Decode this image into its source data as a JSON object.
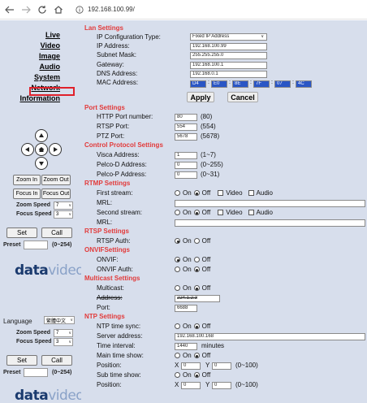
{
  "browser": {
    "url": "192.168.100.99/"
  },
  "sidebar": {
    "links": [
      "Live",
      "Video",
      "Image",
      "Audio",
      "System",
      "Network",
      "Information"
    ],
    "zoom_in": "Zoom In",
    "zoom_out": "Zoom Out",
    "focus_in": "Focus In",
    "focus_out": "Focus Out",
    "zoom_speed_label": "Zoom Speed",
    "zoom_speed_value": "7",
    "focus_speed_label": "Focus Speed",
    "focus_speed_value": "3",
    "set": "Set",
    "call": "Call",
    "preset_label": "Preset",
    "preset_range": "(0~254)",
    "logo_a": "data",
    "logo_b": "video",
    "language_label": "Language",
    "language_value": "繁體中文",
    "zoom_speed2_value": "7",
    "focus_speed2_value": "3",
    "set2": "Set",
    "call2": "Call",
    "preset2_label": "Preset",
    "preset2_range": "(0~254)"
  },
  "lan": {
    "title": "Lan Settings",
    "ip_type_label": "IP Configuration Type:",
    "ip_type_value": "Fixed IP Address",
    "ip_label": "IP Address:",
    "ip_value": "192.168.100.99",
    "mask_label": "Subnet Mask:",
    "mask_value": "255.255.255.0",
    "gateway_label": "Gateway:",
    "gateway_value": "192.168.100.1",
    "dns_label": "DNS Address:",
    "dns_value": "192.168.0.1",
    "mac_label": "MAC Address:",
    "mac": [
      "D4",
      "E0",
      "8E",
      "7F",
      "07",
      "4C"
    ],
    "apply": "Apply",
    "cancel": "Cancel"
  },
  "port": {
    "title": "Port Settings",
    "http_label": "HTTP Port number:",
    "http_value": "80",
    "http_note": "(80)",
    "rtsp_label": "RTSP Port:",
    "rtsp_value": "554",
    "rtsp_note": "(554)",
    "ptz_label": "PTZ Port:",
    "ptz_value": "5678",
    "ptz_note": "(5678)"
  },
  "control": {
    "title": "Control Protocol Settings",
    "visca_label": "Visca Address:",
    "visca_value": "1",
    "visca_note": "(1~7)",
    "pelcod_label": "Pelco-D Address:",
    "pelcod_value": "0",
    "pelcod_note": "(0~255)",
    "pelcop_label": "Pelco-P Address:",
    "pelcop_value": "0",
    "pelcop_note": "(0~31)"
  },
  "rtmp": {
    "title": "RTMP Settings",
    "first_label": "First stream:",
    "on": "On",
    "off": "Off",
    "video": "Video",
    "audio": "Audio",
    "mrl_label": "MRL:",
    "second_label": "Second stream:",
    "mrl2_label": "MRL:"
  },
  "rtsp": {
    "title": "RTSP Settings",
    "auth_label": "RTSP Auth:"
  },
  "onvif": {
    "title": "ONVIFSettings",
    "onvif_label": "ONVIF:",
    "auth_label": "ONVIF Auth:"
  },
  "multicast": {
    "title": "Multicast Settings",
    "multicast_label": "Multicast:",
    "address_label": "Address:",
    "address_value": "224.1.2.3",
    "port_label": "Port:",
    "port_value": "6688"
  },
  "ntp": {
    "title": "NTP Settings",
    "sync_label": "NTP time sync:",
    "server_label": "Server address:",
    "server_value": "192.168.100.168",
    "interval_label": "Time interval:",
    "interval_value": "1440",
    "interval_unit": "minutes",
    "main_show_label": "Main time show:",
    "position_label": "Position:",
    "x": "X",
    "y": "Y",
    "pos_x": "0",
    "pos_y": "0",
    "pos_range": "(0~100)",
    "sub_show_label": "Sub time show:",
    "position2_label": "Position:",
    "pos2_x": "0",
    "pos2_y": "0",
    "pos2_range": "(0~100)"
  },
  "colors": {
    "panel_bg": "#d7deec",
    "section_title": "#e23a3a",
    "highlight": "#e0202a",
    "mac_field": "#2a56c5"
  }
}
